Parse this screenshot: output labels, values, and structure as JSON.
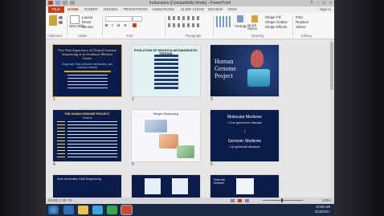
{
  "window": {
    "title": "Indianation [Compatibility Mode] - PowerPoint",
    "controls": [
      "?",
      "–",
      "□",
      "×"
    ]
  },
  "tabs": [
    "FILE",
    "HOME",
    "INSERT",
    "DESIGN",
    "TRANSITIONS",
    "ANIMATIONS",
    "SLIDE SHOW",
    "REVIEW",
    "VIEW"
  ],
  "signin": "Sign in",
  "ribbon": {
    "clipboard": "Clipboard",
    "new_slide": "New Slide",
    "layout": "Layout",
    "reset": "Reset",
    "section": "Section",
    "slides_group": "Slides",
    "font_group": "Font",
    "paragraph_group": "Paragraph",
    "arrange": "Arrange",
    "quick_styles": "Quick Styles",
    "drawing_group": "Drawing",
    "shape_fill": "Shape Fill",
    "shape_outline": "Shape Outline",
    "shape_effects": "Shape Effects",
    "find": "Find",
    "replace": "Replace",
    "select": "Select",
    "editing_group": "Editing"
  },
  "slides": [
    {
      "num": "1",
      "title": "Five-Year Experience of Clinical Genome Sequencing at an Academic Medical Center",
      "subtitle": "Diagnostic Yield, Affected Individual(s), and Lessons Learned"
    },
    {
      "num": "2",
      "title": "EVOLUTION OF MOLECULAR DIAGNOSTIC TESTING"
    },
    {
      "num": "3",
      "title": "Human Genome Project"
    },
    {
      "num": "4",
      "title": "THE HUMAN GENOME PROJECT",
      "subtitle": "Timeline"
    },
    {
      "num": "5",
      "title": "Sanger Sequencing"
    },
    {
      "num": "6",
      "title": "Molecular Medicine",
      "line2": "• One genes/one disease",
      "line3": "Genomic Medicine",
      "line4": "• All genes/all diseases"
    },
    {
      "num": "7",
      "title": "Next-Generation DNA Sequencing"
    },
    {
      "num": "8",
      "title": ""
    },
    {
      "num": "9",
      "title": "Molecular Medicine"
    }
  ],
  "status": {
    "slide_count": "SLIDE 1 OF 75",
    "zoom": "100%"
  },
  "taskbar": {
    "time": "10:56 AM",
    "date": "3/15/2017"
  }
}
